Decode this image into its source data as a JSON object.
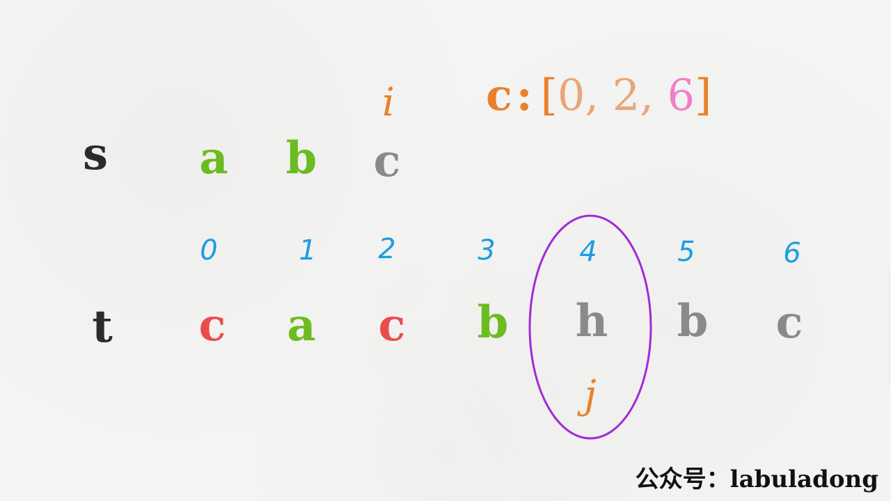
{
  "colors": {
    "green": "#6cbb22",
    "gray": "#8a8a8a",
    "red": "#ec4b4b",
    "blue": "#1a9ee0",
    "orange": "#e8812f",
    "peach": "#e8a678",
    "pink": "#ef80c9",
    "purple": "#a12ad6",
    "dark": "#2b2b2b"
  },
  "s": {
    "label": "s",
    "chars": [
      {
        "char": "a",
        "color": "green"
      },
      {
        "char": "b",
        "color": "green"
      },
      {
        "char": "c",
        "color": "gray"
      }
    ]
  },
  "t": {
    "label": "t",
    "chars": [
      {
        "char": "c",
        "color": "red"
      },
      {
        "char": "a",
        "color": "green"
      },
      {
        "char": "c",
        "color": "red"
      },
      {
        "char": "b",
        "color": "green"
      },
      {
        "char": "h",
        "color": "gray"
      },
      {
        "char": "b",
        "color": "gray"
      },
      {
        "char": "c",
        "color": "gray"
      }
    ],
    "indices": [
      "0",
      "1",
      "2",
      "3",
      "4",
      "5",
      "6"
    ]
  },
  "pointers": {
    "i": {
      "label": "i",
      "points_to_s_index": 2
    },
    "j": {
      "label": "j",
      "points_to_t_index": 4
    }
  },
  "c_array": {
    "name": "c",
    "colon": ":",
    "open": "[",
    "close": "]",
    "values": [
      "0",
      "2",
      "6"
    ],
    "separator": ",",
    "highlight_index": 2
  },
  "highlight": {
    "t_index": 4
  },
  "watermark": "公众号：labuladong"
}
